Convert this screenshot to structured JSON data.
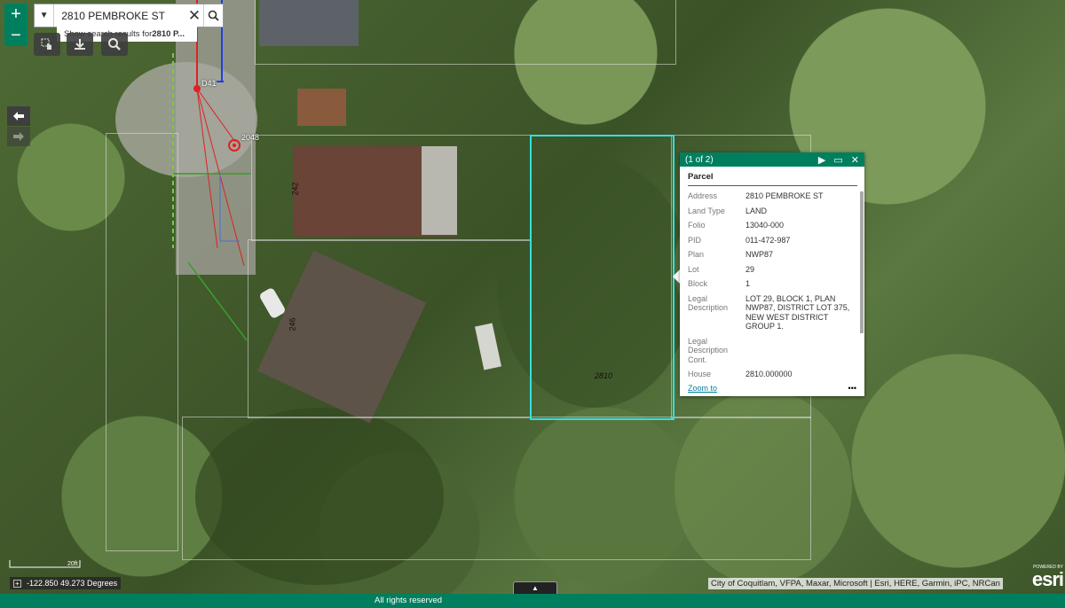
{
  "search": {
    "value": "2810 PEMBROKE ST",
    "suggestion_prefix": "Show search results for ",
    "suggestion_bold": "2810 P..."
  },
  "zoom": {
    "in_label": "+",
    "out_label": "−"
  },
  "map_labels": {
    "lot_2048": "2048",
    "lot_242": "242",
    "lot_246": "246",
    "lot_2810": "2810",
    "marker_d41": "D41"
  },
  "popup": {
    "counter": "(1 of 2)",
    "title": "Parcel",
    "fields": [
      {
        "key": "Address",
        "value": "2810 PEMBROKE ST"
      },
      {
        "key": "Land Type",
        "value": "LAND"
      },
      {
        "key": "Folio",
        "value": "13040-000"
      },
      {
        "key": "PID",
        "value": "011-472-987"
      },
      {
        "key": "Plan",
        "value": "NWP87"
      },
      {
        "key": "Lot",
        "value": "29"
      },
      {
        "key": "Block",
        "value": "1"
      },
      {
        "key": "Legal Description",
        "value": "LOT 29, BLOCK 1, PLAN NWP87, DISTRICT LOT 375, NEW WEST DISTRICT GROUP 1."
      },
      {
        "key": "Legal Description Cont.",
        "value": ""
      },
      {
        "key": "House",
        "value": "2810.000000"
      }
    ],
    "zoom_link": "Zoom to",
    "more": "•••"
  },
  "scale_label": "20ft",
  "coordinates": "-122.850 49.273 Degrees",
  "attribution": "City of Coquitlam, VFPA, Maxar, Microsoft | Esri, HERE, Garmin, iPC, NRCan",
  "esri": {
    "powered_by": "POWERED BY",
    "name": "esri"
  },
  "footer": "All rights reserved",
  "colors": {
    "accent": "#007f5f",
    "selected_parcel": "#31e0e0"
  }
}
